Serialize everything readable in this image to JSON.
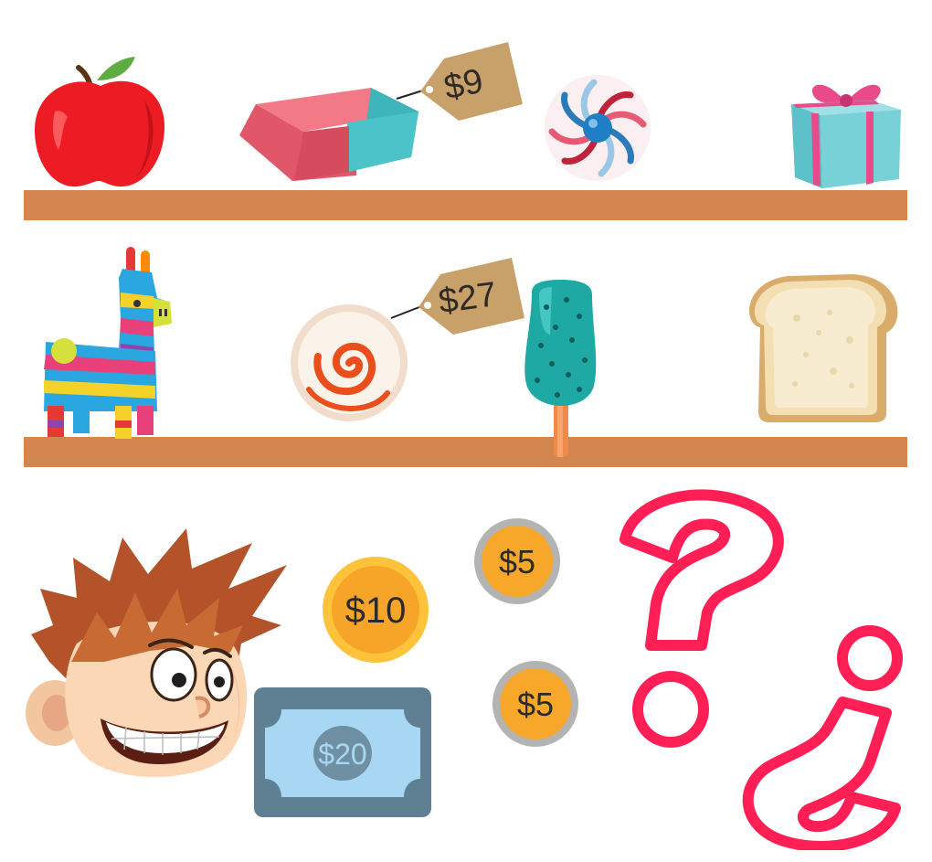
{
  "scene": {
    "shelf_color": "#d3874f",
    "shelves": [
      {
        "items": [
          {
            "name": "apple",
            "icon": "apple-icon"
          },
          {
            "name": "eraser",
            "icon": "eraser-icon",
            "price": "$9"
          },
          {
            "name": "lollipop",
            "icon": "swirl-candy-icon"
          },
          {
            "name": "gift box",
            "icon": "gift-icon"
          }
        ]
      },
      {
        "items": [
          {
            "name": "piñata",
            "icon": "pinata-icon"
          },
          {
            "name": "candy",
            "icon": "round-candy-icon",
            "price": "$27"
          },
          {
            "name": "popsicle",
            "icon": "popsicle-icon"
          },
          {
            "name": "bread",
            "icon": "bread-icon"
          }
        ]
      }
    ],
    "money": {
      "coin_10": "$10",
      "coin_5a": "$5",
      "coin_5b": "$5",
      "bill_20": "$20"
    },
    "colors": {
      "tag": "#c8a06a",
      "coin_gold": "#f7b92a",
      "coin_silver": "#b3b3b3",
      "bill": "#5f7f93",
      "question_marks": "#ff1f55"
    }
  }
}
